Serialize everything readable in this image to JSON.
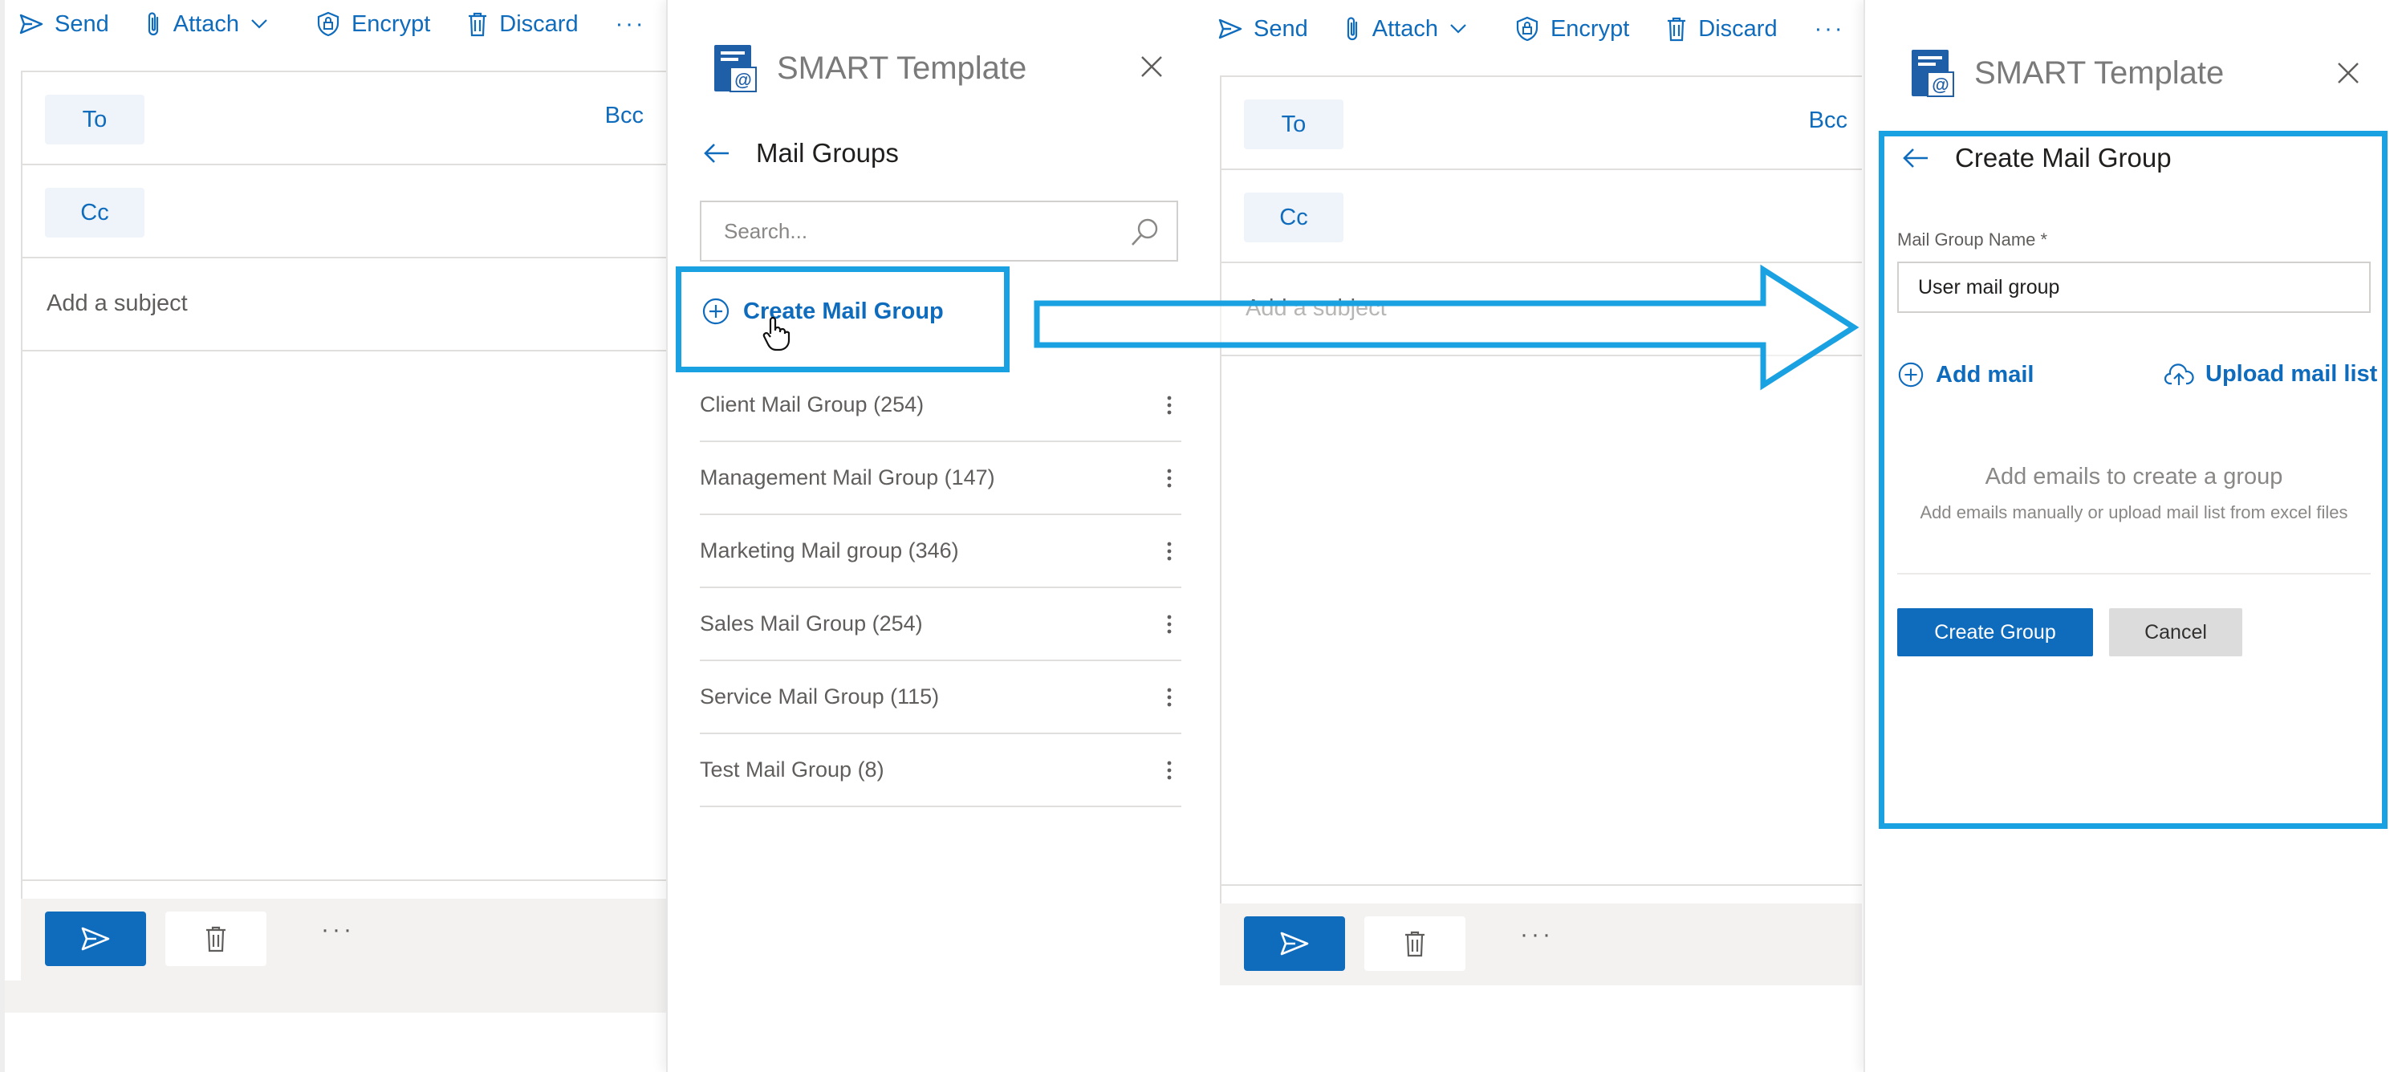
{
  "compose": {
    "toolbar": {
      "send": "Send",
      "attach": "Attach",
      "encrypt": "Encrypt",
      "discard": "Discard",
      "more": "···"
    },
    "to_label": "To",
    "cc_label": "Cc",
    "bcc_label": "Bcc",
    "subject_placeholder": "Add a subject",
    "format_more": "···",
    "bottom_more": "···"
  },
  "panel": {
    "title": "SMART Template"
  },
  "mail_groups": {
    "heading": "Mail Groups",
    "search_placeholder": "Search...",
    "create_label": "Create Mail Group",
    "groups": [
      {
        "label": "Client Mail Group (254)"
      },
      {
        "label": "Management Mail Group (147)"
      },
      {
        "label": "Marketing Mail group (346)"
      },
      {
        "label": "Sales Mail Group (254)"
      },
      {
        "label": "Service Mail Group (115)"
      },
      {
        "label": "Test Mail Group (8)"
      }
    ]
  },
  "create_group": {
    "heading": "Create Mail Group",
    "name_label": "Mail Group Name *",
    "name_value": "User mail group",
    "add_mail": "Add mail",
    "upload_list": "Upload mail list",
    "empty_title": "Add emails to create a group",
    "empty_subtitle": "Add emails manually or upload mail list from excel files",
    "create_button": "Create Group",
    "cancel_button": "Cancel"
  },
  "colors": {
    "accent": "#0f6cbd",
    "highlight": "#1aa1e2"
  }
}
